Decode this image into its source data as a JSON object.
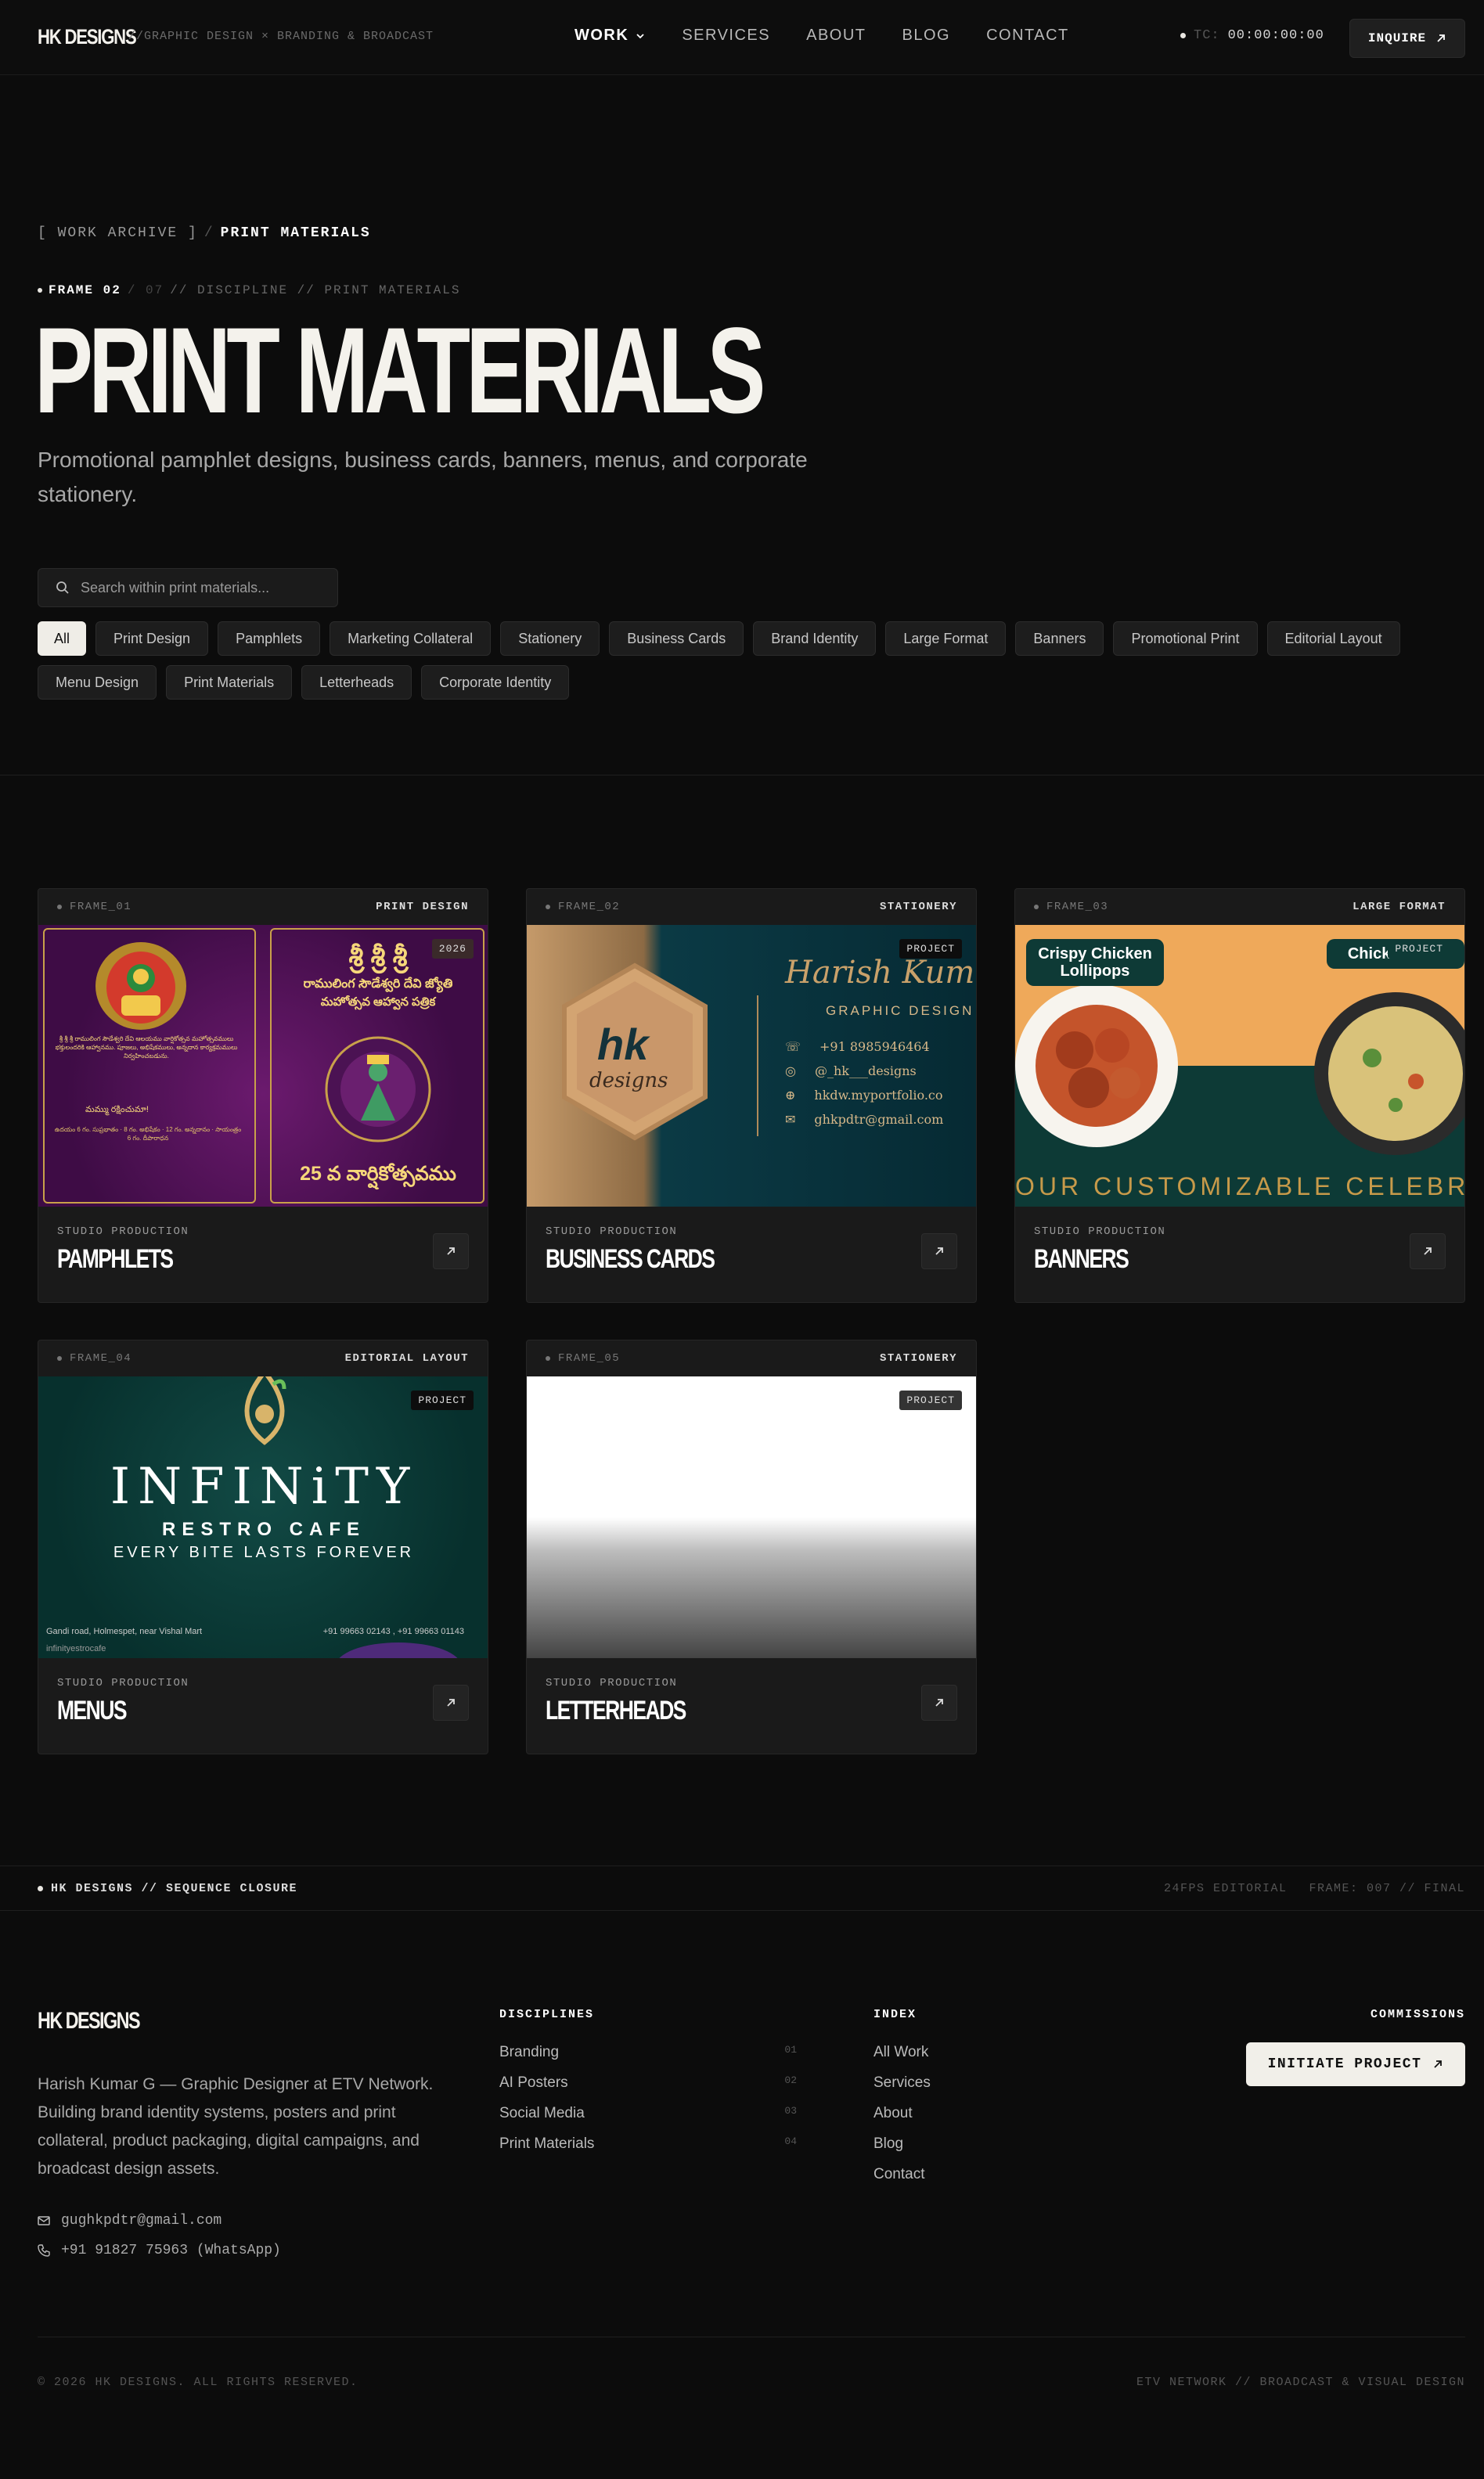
{
  "nav": {
    "logo": "HK DESIGNS",
    "tagline": "//GRAPHIC DESIGN × BRANDING & BROADCAST",
    "links": [
      {
        "label": "WORK"
      },
      {
        "label": "SERVICES"
      },
      {
        "label": "ABOUT"
      },
      {
        "label": "BLOG"
      },
      {
        "label": "CONTACT"
      }
    ],
    "tc_label": "TC:",
    "tc_value": "00:00:00:00",
    "inquire": "INQUIRE"
  },
  "hero": {
    "crumb_root": "[ WORK ARCHIVE ]",
    "crumb_sep": "/",
    "crumb_current": "PRINT MATERIALS",
    "frame_current": "FRAME 02",
    "frame_total": "/ 07",
    "frame_path": "// DISCIPLINE // PRINT MATERIALS",
    "title": "PRINT MATERIALS",
    "lead": "Promotional pamphlet designs, business cards, banners, menus, and corporate stationery."
  },
  "search": {
    "placeholder": "Search within print materials..."
  },
  "filters": [
    "All",
    "Print Design",
    "Pamphlets",
    "Marketing Collateral",
    "Stationery",
    "Business Cards",
    "Brand Identity",
    "Large Format",
    "Banners",
    "Promotional Print",
    "Editorial Layout",
    "Menu Design",
    "Print Materials",
    "Letterheads",
    "Corporate Identity"
  ],
  "cards": [
    {
      "frame": "FRAME_01",
      "category": "PRINT DESIGN",
      "kicker": "STUDIO PRODUCTION",
      "title": "PAMPHLETS",
      "badge": "2026",
      "art": {
        "title_te": "శ్రీ శ్రీ శ్రీ",
        "sub1": "రాములింగ సౌడేశ్వరి దేవి జ్యోతి",
        "sub2": "మహోత్సవ ఆహ్వాన పత్రిక",
        "year_te": "25 వ వార్షికోత్సవము",
        "inner": "మమ్ము రక్షించుమా!"
      }
    },
    {
      "frame": "FRAME_02",
      "category": "STATIONERY",
      "kicker": "STUDIO PRODUCTION",
      "title": "BUSINESS CARDS",
      "badge": "PROJECT",
      "art": {
        "mark": "hk",
        "mark_sub": "designs",
        "script": "Harish Kum",
        "role": "GRAPHIC DESIGN",
        "phone": "+91 8985946464",
        "handle": "@_hk___designs",
        "web": "hkdw.myportfolio.co",
        "mail": "ghkpdtr@gmail.com"
      }
    },
    {
      "frame": "FRAME_03",
      "category": "LARGE FORMAT",
      "kicker": "STUDIO PRODUCTION",
      "title": "BANNERS",
      "badge": "PROJECT",
      "art": {
        "dish1": "Crispy Chicken Lollipops",
        "dish2": "Chick… Rice",
        "strap": "OUR CUSTOMIZABLE CELEBRA"
      }
    },
    {
      "frame": "FRAME_04",
      "category": "EDITORIAL LAYOUT",
      "kicker": "STUDIO PRODUCTION",
      "title": "MENUS",
      "badge": "PROJECT",
      "art": {
        "brand": "INFINiTY",
        "sub": "RESTRO CAFE",
        "tag": "EVERY BITE LASTS FOREVER",
        "addr": "Gandi road, Holmespet, near Vishal Mart",
        "phone": "+91 99663 02143 , +91 99663 01143",
        "social": "infinityestrocafe"
      }
    },
    {
      "frame": "FRAME_05",
      "category": "STATIONERY",
      "kicker": "STUDIO PRODUCTION",
      "title": "LETTERHEADS",
      "badge": "PROJECT"
    }
  ],
  "closure": {
    "left": "HK DESIGNS // SEQUENCE CLOSURE",
    "fps": "24FPS EDITORIAL",
    "frame": "FRAME: 007 // FINAL"
  },
  "footer": {
    "logo": "HK DESIGNS",
    "desc": "Harish Kumar G — Graphic Designer at ETV Network. Building brand identity systems, posters and print collateral, product packaging, digital campaigns, and broadcast design assets.",
    "email": "gughkpdtr@gmail.com",
    "phone": "+91 91827 75963 (WhatsApp)",
    "disciplines_title": "DISCIPLINES",
    "disciplines": [
      {
        "label": "Branding",
        "num": "01"
      },
      {
        "label": "AI Posters",
        "num": "02"
      },
      {
        "label": "Social Media",
        "num": "03"
      },
      {
        "label": "Print Materials",
        "num": "04"
      }
    ],
    "index_title": "INDEX",
    "index": [
      "All Work",
      "Services",
      "About",
      "Blog",
      "Contact"
    ],
    "commissions_title": "COMMISSIONS",
    "initiate": "INITIATE PROJECT",
    "copyright": "© 2026 HK DESIGNS. ALL RIGHTS RESERVED.",
    "network": "ETV NETWORK // BROADCAST & VISUAL DESIGN"
  },
  "colors": {
    "bg": "#0c0c0c",
    "card": "#1a1a1a",
    "accent": "#efede7"
  },
  "icons": {
    "search": "search-icon",
    "arrow": "arrow-up-right-icon",
    "mail": "mail-icon",
    "phone": "phone-icon",
    "chevron": "chevron-down-icon"
  }
}
